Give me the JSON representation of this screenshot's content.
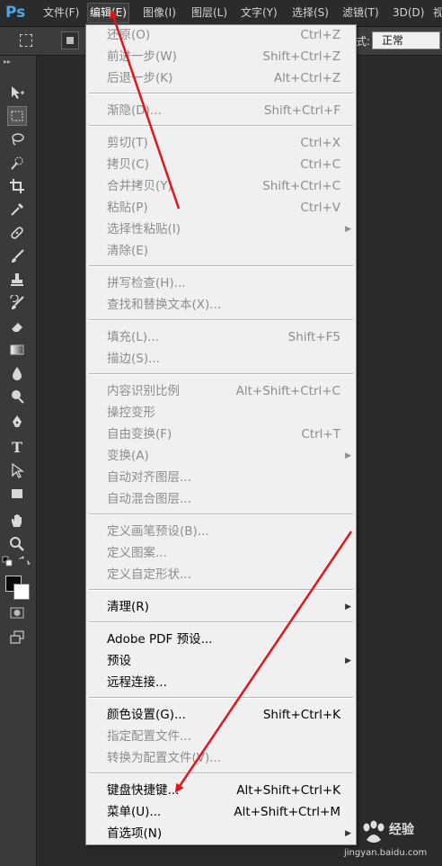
{
  "app": {
    "logo": "Ps"
  },
  "menubar": [
    {
      "label": "文件(F)"
    },
    {
      "label": "编辑(E)"
    },
    {
      "label": "图像(I)"
    },
    {
      "label": "图层(L)"
    },
    {
      "label": "文字(Y)"
    },
    {
      "label": "选择(S)"
    },
    {
      "label": "滤镜(T)"
    },
    {
      "label": "3D(D)"
    },
    {
      "label": "视"
    }
  ],
  "options_bar": {
    "style_label": "式:",
    "style_value": "正常"
  },
  "edit_menu": [
    {
      "label": "还原(O)",
      "shortcut": "Ctrl+Z",
      "enabled": false
    },
    {
      "label": "前进一步(W)",
      "shortcut": "Shift+Ctrl+Z",
      "enabled": false
    },
    {
      "label": "后退一步(K)",
      "shortcut": "Alt+Ctrl+Z",
      "enabled": false
    },
    {
      "label": "渐隐(D)...",
      "shortcut": "Shift+Ctrl+F",
      "enabled": false
    },
    {
      "label": "剪切(T)",
      "shortcut": "Ctrl+X",
      "enabled": false
    },
    {
      "label": "拷贝(C)",
      "shortcut": "Ctrl+C",
      "enabled": false
    },
    {
      "label": "合并拷贝(Y)",
      "shortcut": "Shift+Ctrl+C",
      "enabled": false
    },
    {
      "label": "粘贴(P)",
      "shortcut": "Ctrl+V",
      "enabled": false
    },
    {
      "label": "选择性粘贴(I)",
      "shortcut": "",
      "enabled": false
    },
    {
      "label": "清除(E)",
      "shortcut": "",
      "enabled": false
    },
    {
      "label": "拼写检查(H)...",
      "shortcut": "",
      "enabled": false
    },
    {
      "label": "查找和替换文本(X)...",
      "shortcut": "",
      "enabled": false
    },
    {
      "label": "填充(L)...",
      "shortcut": "Shift+F5",
      "enabled": false
    },
    {
      "label": "描边(S)...",
      "shortcut": "",
      "enabled": false
    },
    {
      "label": "内容识别比例",
      "shortcut": "Alt+Shift+Ctrl+C",
      "enabled": false
    },
    {
      "label": "操控变形",
      "shortcut": "",
      "enabled": false
    },
    {
      "label": "自由变换(F)",
      "shortcut": "Ctrl+T",
      "enabled": false
    },
    {
      "label": "变换(A)",
      "shortcut": "",
      "enabled": false
    },
    {
      "label": "自动对齐图层...",
      "shortcut": "",
      "enabled": false
    },
    {
      "label": "自动混合图层...",
      "shortcut": "",
      "enabled": false
    },
    {
      "label": "定义画笔预设(B)...",
      "shortcut": "",
      "enabled": false
    },
    {
      "label": "定义图案...",
      "shortcut": "",
      "enabled": false
    },
    {
      "label": "定义自定形状...",
      "shortcut": "",
      "enabled": false
    },
    {
      "label": "清理(R)",
      "shortcut": "",
      "enabled": true
    },
    {
      "label": "Adobe PDF 预设...",
      "shortcut": "",
      "enabled": true
    },
    {
      "label": "预设",
      "shortcut": "",
      "enabled": true
    },
    {
      "label": "远程连接...",
      "shortcut": "",
      "enabled": true
    },
    {
      "label": "颜色设置(G)...",
      "shortcut": "Shift+Ctrl+K",
      "enabled": true
    },
    {
      "label": "指定配置文件...",
      "shortcut": "",
      "enabled": false
    },
    {
      "label": "转换为配置文件(V)...",
      "shortcut": "",
      "enabled": false
    },
    {
      "label": "键盘快捷键...",
      "shortcut": "Alt+Shift+Ctrl+K",
      "enabled": true
    },
    {
      "label": "菜单(U)...",
      "shortcut": "Alt+Shift+Ctrl+M",
      "enabled": true
    },
    {
      "label": "首选项(N)",
      "shortcut": "",
      "enabled": true
    }
  ],
  "watermark": {
    "brand": "经验",
    "url": "jingyan.baidu.com"
  },
  "colors": {
    "arrow": "#e0161b",
    "menu_bg": "#f0f0f0",
    "disabled_text": "#8d8d8d",
    "app_bg": "#282828"
  }
}
